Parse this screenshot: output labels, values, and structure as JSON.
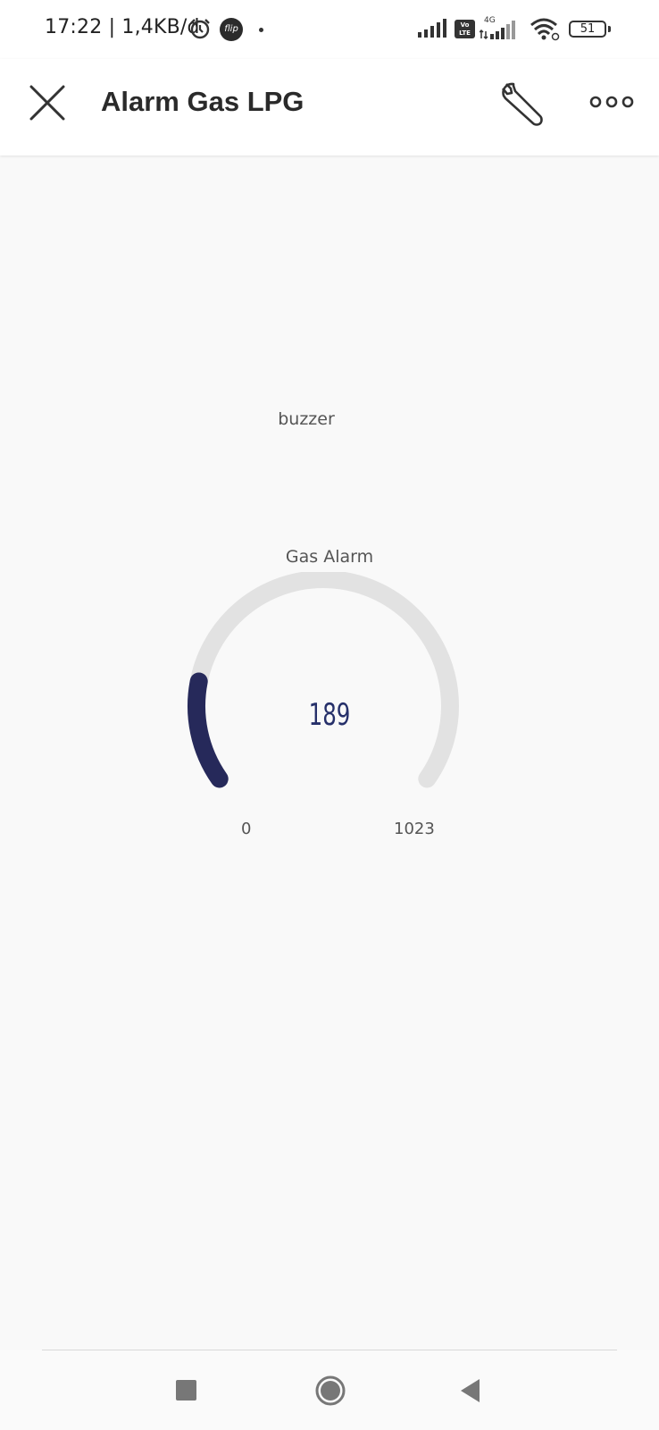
{
  "status_bar": {
    "time_text": "17:22 | 1,4KB/d",
    "flip_badge": "flip",
    "volte_label": "Vo LTE",
    "network_label": "4G",
    "battery_level": "51"
  },
  "app_bar": {
    "title": "Alarm Gas LPG",
    "icons": [
      "close-icon",
      "wrench-icon",
      "more-icon"
    ]
  },
  "widgets": {
    "buzzer_label": "buzzer",
    "gauge": {
      "title": "Gas Alarm",
      "value": 189,
      "value_text": "189",
      "min": 0,
      "min_text": "0",
      "max": 1023,
      "max_text": "1023",
      "fill_color": "#26295a",
      "track_color": "#e2e2e2"
    }
  },
  "nav_bar": {
    "icons": [
      "recents-icon",
      "home-icon",
      "back-icon"
    ]
  }
}
